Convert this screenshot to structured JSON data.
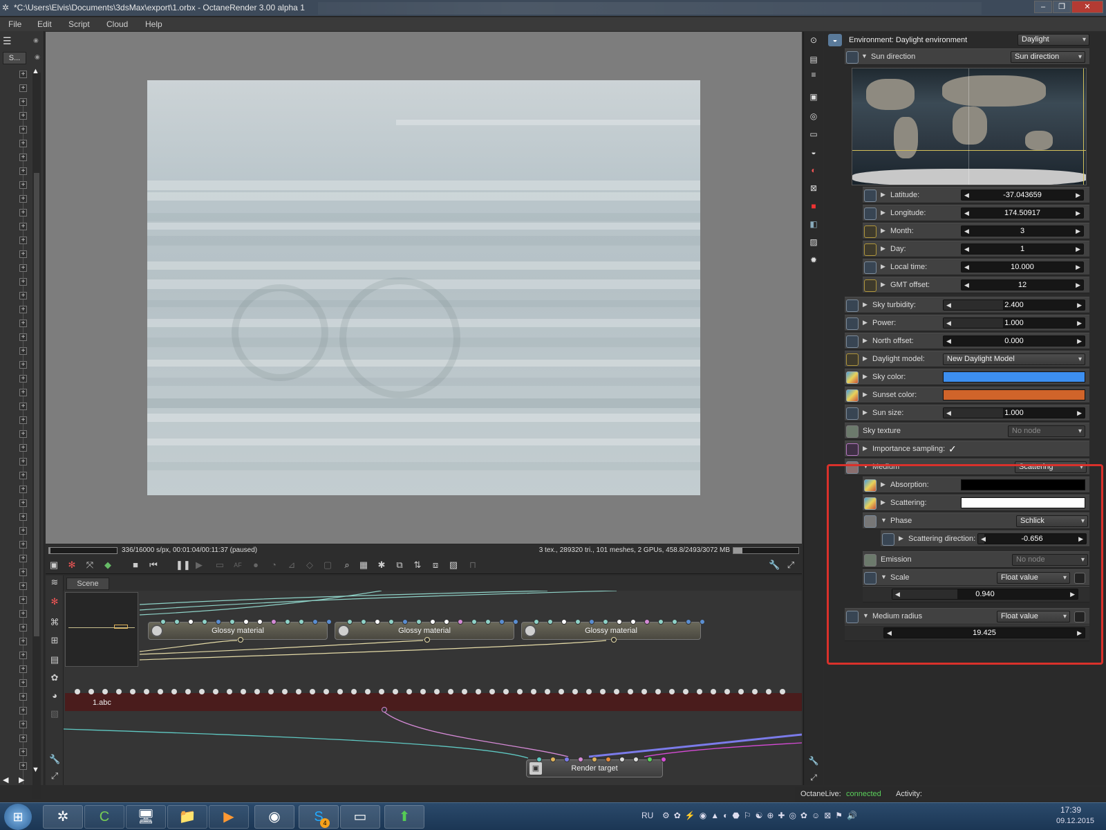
{
  "window": {
    "title": "*C:\\Users\\Elvis\\Documents\\3dsMax\\export\\1.orbx - OctaneRender 3.00 alpha 1",
    "minimize": "–",
    "maximize": "❐",
    "close": "✕"
  },
  "menu": {
    "file": "File",
    "edit": "Edit",
    "script": "Script",
    "cloud": "Cloud",
    "help": "Help"
  },
  "left_panel": {
    "tab_label": "S..."
  },
  "viewport": {
    "status_left": "336/16000 s/px, 00:01:04/00:11:37 (paused)",
    "status_right": "3 tex., 289320 tri., 101 meshes, 2 GPUs, 458.8/2493/3072 MB",
    "render_progress": 0.021
  },
  "node_editor": {
    "tab": "Scene",
    "nodes": [
      "Glossy material",
      "Glossy material",
      "Glossy material"
    ],
    "mesh_node": "1.abc",
    "render_target": "Render target"
  },
  "environment": {
    "header": "Environment: Daylight environment",
    "type": "Daylight",
    "sun_direction_label": "Sun direction",
    "sun_direction_mode": "Sun direction",
    "params": [
      {
        "label": "Latitude:",
        "value": "-37.043659"
      },
      {
        "label": "Longitude:",
        "value": "174.50917"
      },
      {
        "label": "Month:",
        "value": "3"
      },
      {
        "label": "Day:",
        "value": "1"
      },
      {
        "label": "Local time:",
        "value": "10.000"
      },
      {
        "label": "GMT offset:",
        "value": "12"
      }
    ],
    "sky_turbidity": {
      "label": "Sky turbidity:",
      "value": "2.400"
    },
    "power": {
      "label": "Power:",
      "value": "1.000"
    },
    "north_offset": {
      "label": "North offset:",
      "value": "0.000"
    },
    "daylight_model": {
      "label": "Daylight model:",
      "value": "New Daylight Model"
    },
    "sky_color": {
      "label": "Sky color:",
      "color": "#3d8ff0"
    },
    "sunset_color": {
      "label": "Sunset color:",
      "color": "#d0642a"
    },
    "sun_size": {
      "label": "Sun size:",
      "value": "1.000"
    },
    "sky_texture": {
      "label": "Sky texture",
      "value": "No node"
    },
    "importance_sampling": {
      "label": "Importance sampling:",
      "check": "✓"
    }
  },
  "medium": {
    "label": "Medium",
    "type": "Scattering",
    "absorption": {
      "label": "Absorption:",
      "color": "#000000"
    },
    "scattering": {
      "label": "Scattering:",
      "color": "#ffffff"
    },
    "phase": {
      "label": "Phase",
      "type": "Schlick"
    },
    "scattering_direction": {
      "label": "Scattering direction:",
      "value": "-0.656"
    },
    "emission": {
      "label": "Emission",
      "value": "No node"
    },
    "scale": {
      "label": "Scale",
      "type": "Float value",
      "value": "0.940"
    },
    "medium_radius": {
      "label": "Medium radius",
      "type": "Float value",
      "value": "19.425"
    }
  },
  "status": {
    "octanelive_label": "OctaneLive:",
    "octanelive_state": "connected",
    "activity_label": "Activity:"
  },
  "taskbar": {
    "lang": "RU",
    "time": "17:39",
    "date": "09.12.2015",
    "skype_badge": "4"
  }
}
